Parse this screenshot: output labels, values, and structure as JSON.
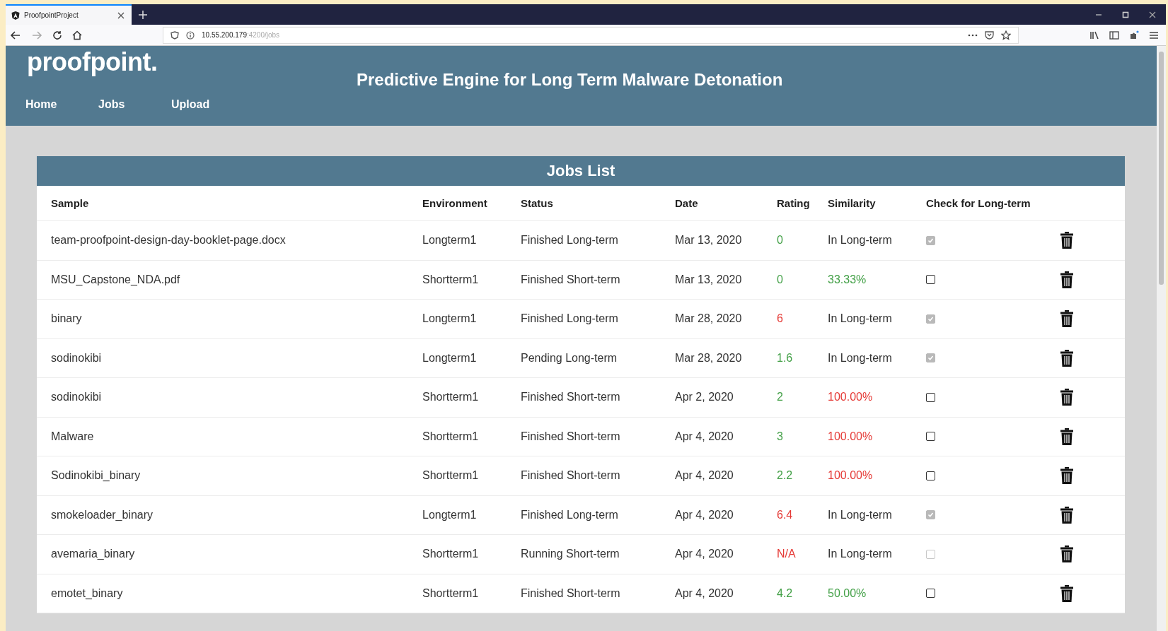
{
  "browser": {
    "tab_title": "ProofpointProject",
    "url_host": "10.55.200.179",
    "url_path": ":4200/jobs"
  },
  "header": {
    "logo": "proofpoint.",
    "title": "Predictive Engine for Long Term Malware Detonation",
    "nav": [
      {
        "label": "Home"
      },
      {
        "label": "Jobs"
      },
      {
        "label": "Upload"
      }
    ]
  },
  "jobs": {
    "title": "Jobs List",
    "columns": [
      "Sample",
      "Environment",
      "Status",
      "Date",
      "Rating",
      "Similarity",
      "Check for Long-term"
    ],
    "rows": [
      {
        "sample": "team-proofpoint-design-day-booklet-page.docx",
        "environment": "Longterm1",
        "status": "Finished Long-term",
        "date": "Mar 13, 2020",
        "rating": {
          "text": "0",
          "color": "#43a047"
        },
        "similarity": {
          "text": "In Long-term",
          "color": "#333333"
        },
        "check": {
          "checked": true,
          "disabled": true
        }
      },
      {
        "sample": "MSU_Capstone_NDA.pdf",
        "environment": "Shortterm1",
        "status": "Finished Short-term",
        "date": "Mar 13, 2020",
        "rating": {
          "text": "0",
          "color": "#43a047"
        },
        "similarity": {
          "text": "33.33%",
          "color": "#43a047"
        },
        "check": {
          "checked": false,
          "disabled": false
        }
      },
      {
        "sample": "binary",
        "environment": "Longterm1",
        "status": "Finished Long-term",
        "date": "Mar 28, 2020",
        "rating": {
          "text": "6",
          "color": "#e53935"
        },
        "similarity": {
          "text": "In Long-term",
          "color": "#333333"
        },
        "check": {
          "checked": true,
          "disabled": true
        }
      },
      {
        "sample": "sodinokibi",
        "environment": "Longterm1",
        "status": "Pending Long-term",
        "date": "Mar 28, 2020",
        "rating": {
          "text": "1.6",
          "color": "#43a047"
        },
        "similarity": {
          "text": "In Long-term",
          "color": "#333333"
        },
        "check": {
          "checked": true,
          "disabled": true
        }
      },
      {
        "sample": "sodinokibi",
        "environment": "Shortterm1",
        "status": "Finished Short-term",
        "date": "Apr 2, 2020",
        "rating": {
          "text": "2",
          "color": "#43a047"
        },
        "similarity": {
          "text": "100.00%",
          "color": "#e53935"
        },
        "check": {
          "checked": false,
          "disabled": false
        }
      },
      {
        "sample": "Malware",
        "environment": "Shortterm1",
        "status": "Finished Short-term",
        "date": "Apr 4, 2020",
        "rating": {
          "text": "3",
          "color": "#43a047"
        },
        "similarity": {
          "text": "100.00%",
          "color": "#e53935"
        },
        "check": {
          "checked": false,
          "disabled": false
        }
      },
      {
        "sample": "Sodinokibi_binary",
        "environment": "Shortterm1",
        "status": "Finished Short-term",
        "date": "Apr 4, 2020",
        "rating": {
          "text": "2.2",
          "color": "#43a047"
        },
        "similarity": {
          "text": "100.00%",
          "color": "#e53935"
        },
        "check": {
          "checked": false,
          "disabled": false
        }
      },
      {
        "sample": "smokeloader_binary",
        "environment": "Longterm1",
        "status": "Finished Long-term",
        "date": "Apr 4, 2020",
        "rating": {
          "text": "6.4",
          "color": "#e53935"
        },
        "similarity": {
          "text": "In Long-term",
          "color": "#333333"
        },
        "check": {
          "checked": true,
          "disabled": true
        }
      },
      {
        "sample": "avemaria_binary",
        "environment": "Shortterm1",
        "status": "Running Short-term",
        "date": "Apr 4, 2020",
        "rating": {
          "text": "N/A",
          "color": "#e53935"
        },
        "similarity": {
          "text": "In Long-term",
          "color": "#333333"
        },
        "check": {
          "checked": false,
          "disabled": true
        }
      },
      {
        "sample": "emotet_binary",
        "environment": "Shortterm1",
        "status": "Finished Short-term",
        "date": "Apr 4, 2020",
        "rating": {
          "text": "4.2",
          "color": "#43a047"
        },
        "similarity": {
          "text": "50.00%",
          "color": "#43a047"
        },
        "check": {
          "checked": false,
          "disabled": false
        }
      }
    ]
  }
}
